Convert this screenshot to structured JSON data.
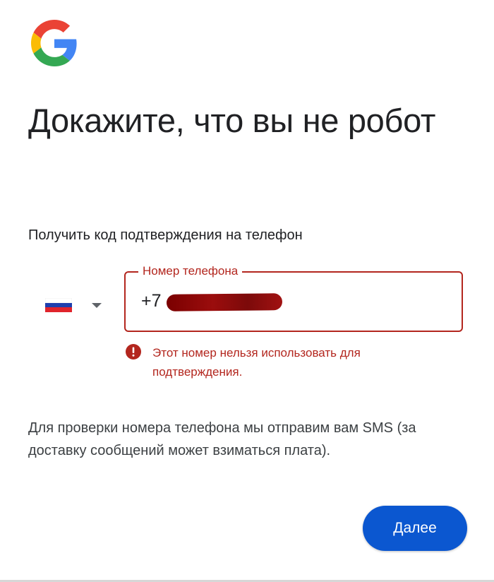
{
  "brand": {
    "logo_icon": "google-g-logo"
  },
  "title": "Докажите, что вы не робот",
  "subtitle": "Получить код подтверждения на телефон",
  "country_selector": {
    "flag_icon": "russia-flag-icon",
    "caret_icon": "caret-down-icon"
  },
  "phone_field": {
    "label": "Номер телефона",
    "value_prefix": "+7",
    "redacted": true
  },
  "error": {
    "icon": "error-icon",
    "message": "Этот номер нельзя использовать для подтверждения."
  },
  "info_text": "Для проверки номера телефона мы отправим вам SMS (за доставку сообщений может взиматься плата).",
  "next_button": {
    "label": "Далее"
  },
  "colors": {
    "error": "#b3261e",
    "primary_button": "#0b57d0",
    "text": "#202124"
  }
}
